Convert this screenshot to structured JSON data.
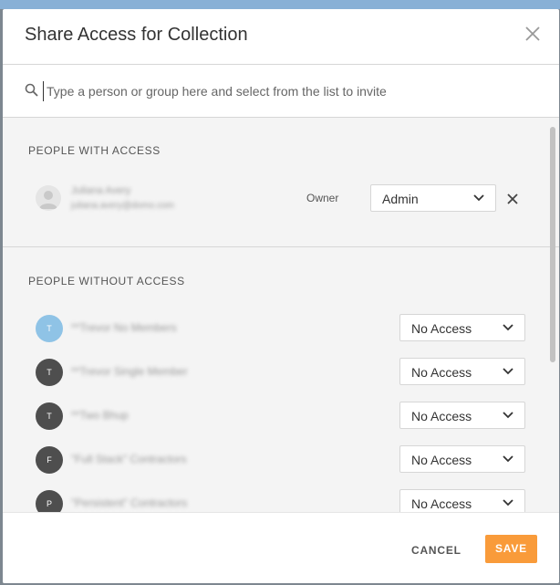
{
  "modal": {
    "title": "Share Access for Collection"
  },
  "search": {
    "placeholder": "Type a person or group here and select from the list to invite",
    "value": ""
  },
  "with_access": {
    "heading": "PEOPLE WITH ACCESS",
    "person": {
      "name": "Juliana Avery",
      "email": "juliana.avery@domo.com",
      "role": "Owner",
      "permission": "Admin"
    }
  },
  "without_access": {
    "heading": "PEOPLE WITHOUT ACCESS",
    "items": [
      {
        "initial": "T",
        "name": "**Trevor No Members",
        "permission": "No Access",
        "avatar_color": "#8fc3e6"
      },
      {
        "initial": "T",
        "name": "**Trevor Single Member",
        "permission": "No Access",
        "avatar_color": "#4e4e4e"
      },
      {
        "initial": "T",
        "name": "**Two Bhup",
        "permission": "No Access",
        "avatar_color": "#4e4e4e"
      },
      {
        "initial": "F",
        "name": "\"Full Stack\" Contractors",
        "permission": "No Access",
        "avatar_color": "#4e4e4e"
      },
      {
        "initial": "P",
        "name": "\"Persistent\" Contractors",
        "permission": "No Access",
        "avatar_color": "#4e4e4e"
      }
    ]
  },
  "footer": {
    "cancel_label": "CANCEL",
    "save_label": "SAVE"
  },
  "colors": {
    "accent": "#f99b3a",
    "overlay": "#7d8790"
  }
}
